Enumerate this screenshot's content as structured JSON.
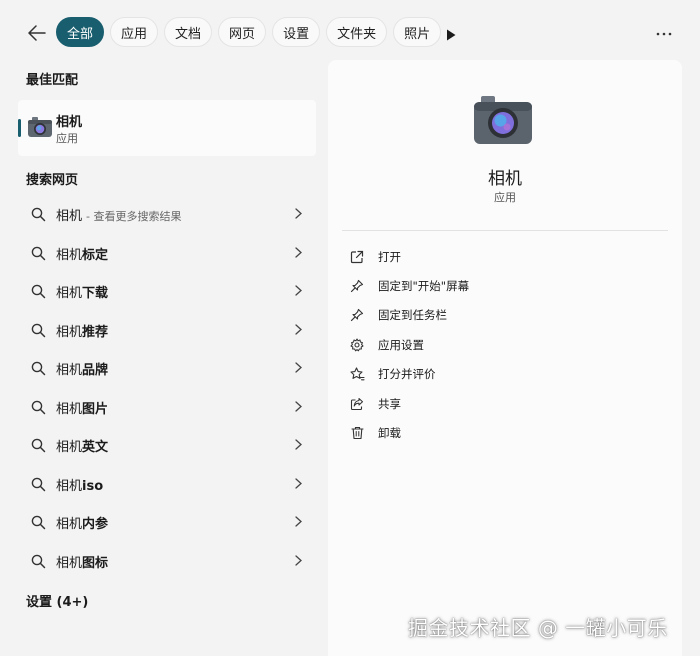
{
  "filters": {
    "tabs": [
      {
        "label": "全部",
        "active": true
      },
      {
        "label": "应用",
        "active": false
      },
      {
        "label": "文档",
        "active": false
      },
      {
        "label": "网页",
        "active": false
      },
      {
        "label": "设置",
        "active": false
      },
      {
        "label": "文件夹",
        "active": false
      },
      {
        "label": "照片",
        "active": false
      }
    ]
  },
  "left": {
    "best_match_title": "最佳匹配",
    "best_match": {
      "name": "相机",
      "type": "应用"
    },
    "web_title": "搜索网页",
    "web_results": [
      {
        "prefix": "相机",
        "suffix": "",
        "sub": "- 查看更多搜索结果"
      },
      {
        "prefix": "相机",
        "suffix": "标定",
        "sub": ""
      },
      {
        "prefix": "相机",
        "suffix": "下载",
        "sub": ""
      },
      {
        "prefix": "相机",
        "suffix": "推荐",
        "sub": ""
      },
      {
        "prefix": "相机",
        "suffix": "品牌",
        "sub": ""
      },
      {
        "prefix": "相机",
        "suffix": "图片",
        "sub": ""
      },
      {
        "prefix": "相机",
        "suffix": "英文",
        "sub": ""
      },
      {
        "prefix": "相机",
        "suffix": "iso",
        "sub": ""
      },
      {
        "prefix": "相机",
        "suffix": "内参",
        "sub": ""
      },
      {
        "prefix": "相机",
        "suffix": "图标",
        "sub": ""
      }
    ],
    "settings_title": "设置 (4+)"
  },
  "detail": {
    "title": "相机",
    "type": "应用",
    "actions": [
      {
        "label": "打开",
        "icon": "open-external-icon"
      },
      {
        "label": "固定到\"开始\"屏幕",
        "icon": "pin-icon"
      },
      {
        "label": "固定到任务栏",
        "icon": "pin-icon"
      },
      {
        "label": "应用设置",
        "icon": "gear-icon"
      },
      {
        "label": "打分并评价",
        "icon": "star-rate-icon"
      },
      {
        "label": "共享",
        "icon": "share-icon"
      },
      {
        "label": "卸载",
        "icon": "trash-icon"
      }
    ]
  },
  "watermark": "掘金技术社区 @ 一罐小可乐",
  "colors": {
    "accent": "#195e6f",
    "background": "#f3f3f3",
    "panel": "#fbfbfb"
  }
}
